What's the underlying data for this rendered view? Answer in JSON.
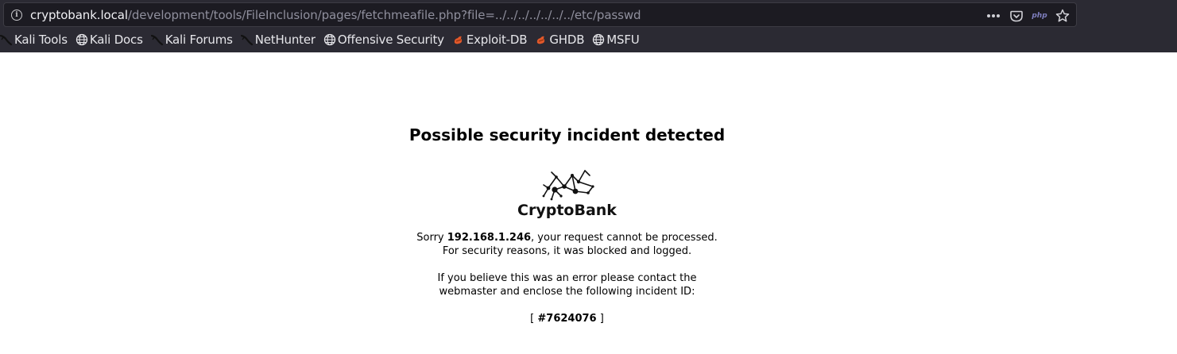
{
  "browser": {
    "url_host": "cryptobank.local",
    "url_path": "/development/tools/FileInclusion/pages/fetchmeafile.php?file=../../../../../../../etc/passwd",
    "actions": [
      {
        "icon": "more-actions-icon"
      },
      {
        "icon": "pocket-icon"
      },
      {
        "icon": "php-extension-icon",
        "label": "php"
      },
      {
        "icon": "bookmark-star-icon"
      }
    ]
  },
  "bookmarks": [
    {
      "label": "Kali Tools",
      "icon": "kali-dragon-icon"
    },
    {
      "label": "Kali Docs",
      "icon": "globe-icon"
    },
    {
      "label": "Kali Forums",
      "icon": "kali-dragon-icon"
    },
    {
      "label": "NetHunter",
      "icon": "kali-dragon-icon"
    },
    {
      "label": "Offensive Security",
      "icon": "globe-icon"
    },
    {
      "label": "Exploit-DB",
      "icon": "exploit-db-icon"
    },
    {
      "label": "GHDB",
      "icon": "exploit-db-icon"
    },
    {
      "label": "MSFU",
      "icon": "globe-icon"
    }
  ],
  "page": {
    "title": "Possible security incident detected",
    "logo_text": "CryptoBank",
    "sorry_prefix": "Sorry ",
    "ip": "192.168.1.246",
    "sorry_suffix": ", your request cannot be processed.",
    "line2": "For security reasons, it was blocked and logged.",
    "line3": "If you believe this was an error please contact the",
    "line4": "webmaster and enclose the following incident ID:",
    "incident_open": "[ ",
    "incident_id": "#7624076",
    "incident_close": " ]"
  },
  "colors": {
    "chrome_bg": "#2b2a33",
    "urlbar_bg": "#1c1b22",
    "exploit_db_orange": "#e0582a",
    "page_bg": "#ffffff"
  }
}
